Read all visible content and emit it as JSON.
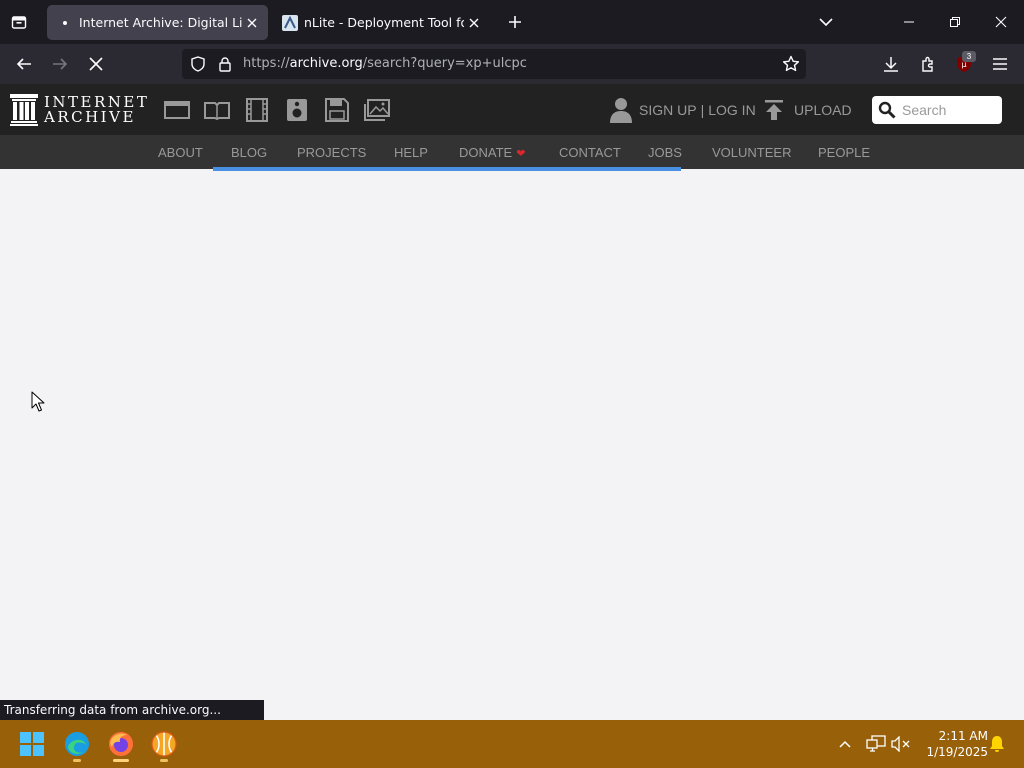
{
  "browser": {
    "tabs": [
      {
        "title": "Internet Archive: Digital Library",
        "active": true
      },
      {
        "title": "nLite - Deployment Tool for the",
        "active": false
      }
    ],
    "url": {
      "scheme": "https://",
      "domain": "archive.org",
      "path": "/search?query=xp+ulcpc"
    },
    "extension_badge": "3",
    "status_text": "Transferring data from archive.org..."
  },
  "ia_header": {
    "logo_line1": "INTERNET",
    "logo_line2": "ARCHIVE",
    "media_icons": [
      "web-icon",
      "texts-icon",
      "video-icon",
      "audio-icon",
      "software-icon",
      "images-icon"
    ],
    "sign_up": "SIGN UP",
    "separator": "|",
    "log_in": "LOG IN",
    "upload": "UPLOAD",
    "search_placeholder": "Search"
  },
  "ia_nav": {
    "items": [
      "ABOUT",
      "BLOG",
      "PROJECTS",
      "HELP",
      "DONATE",
      "CONTACT",
      "JOBS",
      "VOLUNTEER",
      "PEOPLE"
    ]
  },
  "taskbar": {
    "apps": [
      "windows-start-icon",
      "edge-icon",
      "firefox-icon",
      "orange-app-icon"
    ],
    "time": "2:11 AM",
    "date": "1/19/2025"
  },
  "colors": {
    "ia_header_bg": "#222222",
    "ia_nav_bg": "#333333",
    "loading_bar": "#4a90e2",
    "taskbar_bg": "#99600a",
    "donate_heart": "#d9272e"
  }
}
